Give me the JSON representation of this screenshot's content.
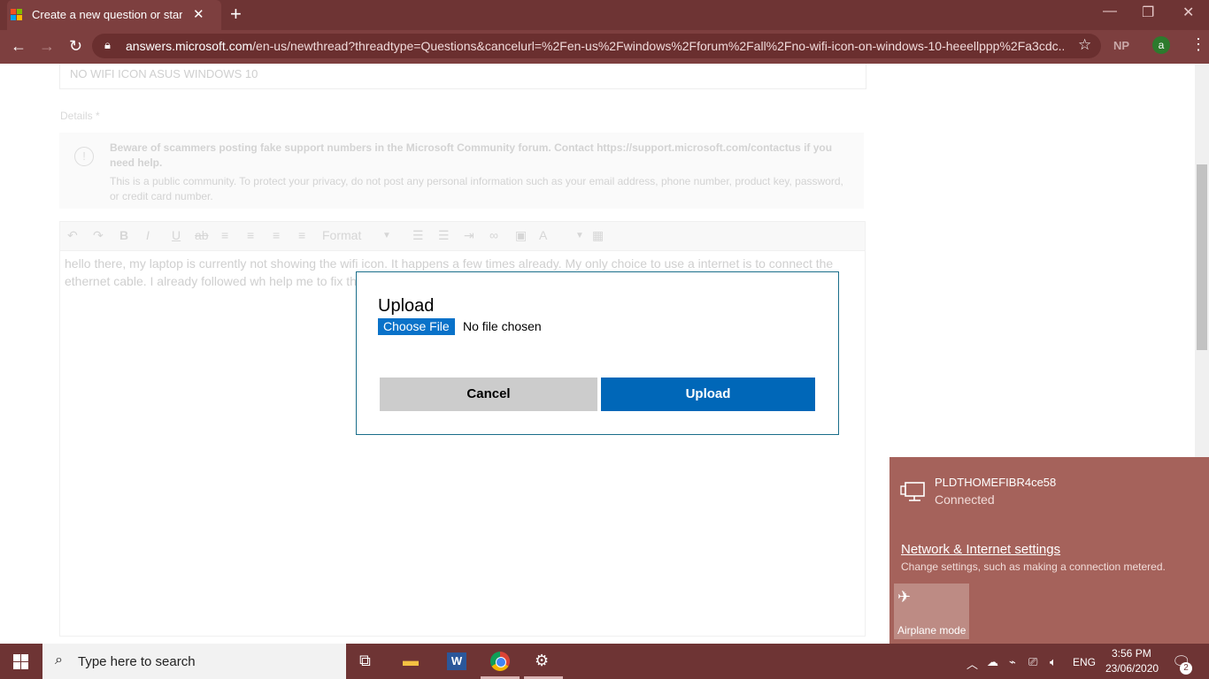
{
  "browser": {
    "tab_title": "Create a new question or start a d",
    "url_domain": "answers.microsoft.com",
    "url_rest": "/en-us/newthread?threadtype=Questions&cancelurl=%2Fen-us%2Fwindows%2Fforum%2Fall%2Fno-wifi-icon-on-windows-10-heeellppp%2Fa3cdc...",
    "profile_badge": "NP",
    "avatar_letter": "a"
  },
  "form": {
    "title_value": "NO WIFI ICON ASUS WINDOWS 10",
    "details_label": "Details *",
    "notice_warning": "Beware of scammers posting fake support numbers in the Microsoft Community forum. Contact https://support.microsoft.com/contactus if you need help.",
    "notice_info": "This is a public community. To protect your privacy, do not post any personal information such as your email address, phone number, product key, password, or credit card number.",
    "toolbar_format": "Format",
    "editor_text": "hello there, my laptop is currently not showing the wifi icon. It happens a few times already. My only choice to use a internet is to connect the ethernet cable. I already followed wh help me to fix this."
  },
  "dialog": {
    "title": "Upload",
    "choose_file": "Choose File",
    "no_file": "No file chosen",
    "cancel": "Cancel",
    "upload": "Upload"
  },
  "network": {
    "ssid": "PLDTHOMEFIBR4ce58",
    "status": "Connected",
    "settings_link": "Network & Internet settings",
    "settings_desc": "Change settings, such as making a connection metered.",
    "airplane_label": "Airplane mode"
  },
  "taskbar": {
    "search_placeholder": "Type here to search",
    "language": "ENG",
    "time": "3:56 PM",
    "date": "23/06/2020",
    "notification_count": "2"
  },
  "colors": {
    "chrome_frame": "#6e3434",
    "flyout": "#a5625b",
    "upload_blue": "#0067b8"
  }
}
